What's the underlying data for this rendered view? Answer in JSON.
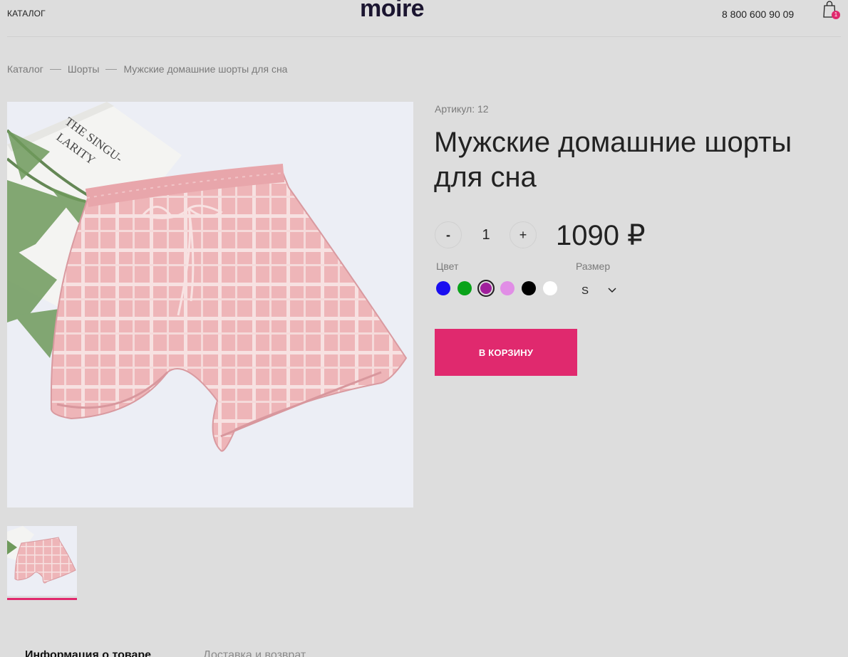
{
  "header": {
    "catalog_label": "КАТАЛОГ",
    "logo_text": "moire",
    "phone": "8 800 600 90 09",
    "cart_count": "1",
    "accent_color": "#e0296e"
  },
  "breadcrumb": {
    "items": [
      "Каталог",
      "Шорты",
      "Мужские домашние шорты для сна"
    ]
  },
  "gallery": {
    "main_image": "pink-plaid-shorts-photo",
    "thumbnails": [
      "pink-plaid-shorts-thumbnail"
    ],
    "book_text": "THE SINGU- LARITY"
  },
  "product": {
    "article": "Артикул: 12",
    "title": "Мужские домашние шорты для сна",
    "quantity": "1",
    "minus_label": "-",
    "plus_label": "+",
    "price": "1090 ₽",
    "color_label": "Цвет",
    "size_label": "Размер",
    "colors": [
      "#1a0ef0",
      "#0aa31a",
      "#a01f9c",
      "#e18ee6",
      "#000000",
      "#ffffff"
    ],
    "selected_color_index": 2,
    "size_value": "S",
    "add_to_cart_label": "В КОРЗИНУ"
  },
  "tabs": [
    {
      "label": "Информация о товаре",
      "active": true
    },
    {
      "label": "Доставка и возврат",
      "active": false
    }
  ]
}
